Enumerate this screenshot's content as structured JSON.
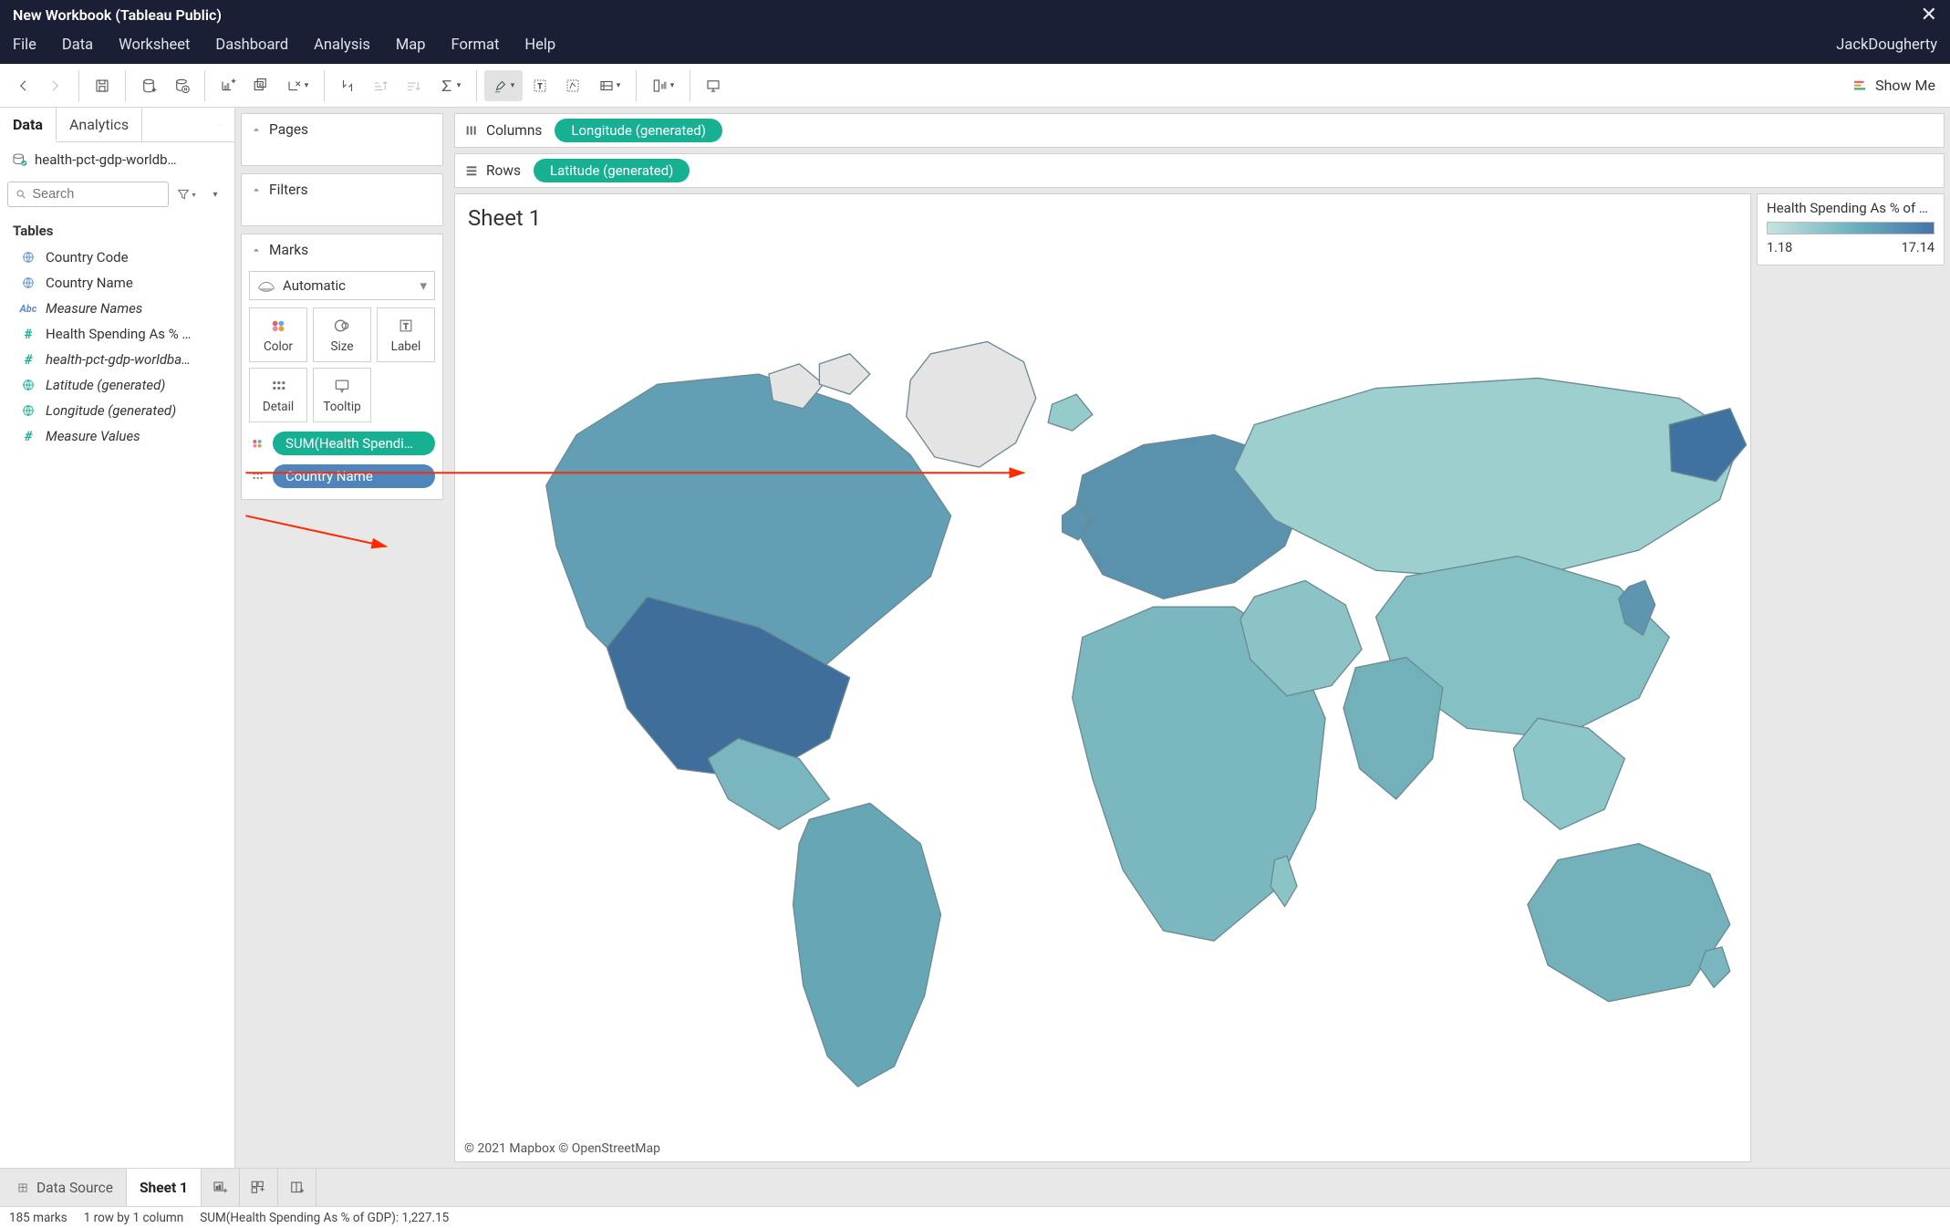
{
  "titlebar": {
    "title": "New Workbook (Tableau Public)"
  },
  "menubar": {
    "items": [
      "File",
      "Data",
      "Worksheet",
      "Dashboard",
      "Analysis",
      "Map",
      "Format",
      "Help"
    ],
    "user": "JackDougherty"
  },
  "showme_label": "Show Me",
  "sidebar": {
    "tabs": {
      "data": "Data",
      "analytics": "Analytics"
    },
    "datasource": "health-pct-gdp-worldb…",
    "search_placeholder": "Search",
    "tables_header": "Tables",
    "fields": [
      {
        "icon": "globe-blue",
        "label": "Country Code",
        "italic": false
      },
      {
        "icon": "globe-blue",
        "label": "Country Name",
        "italic": false
      },
      {
        "icon": "abc",
        "label": "Measure Names",
        "italic": true
      },
      {
        "icon": "hash-green",
        "label": "Health Spending As % …",
        "italic": false
      },
      {
        "icon": "hash-green",
        "label": "health-pct-gdp-worldba…",
        "italic": true
      },
      {
        "icon": "globe-green",
        "label": "Latitude (generated)",
        "italic": true
      },
      {
        "icon": "globe-green",
        "label": "Longitude (generated)",
        "italic": true
      },
      {
        "icon": "hash-green",
        "label": "Measure Values",
        "italic": true
      }
    ]
  },
  "shelves": {
    "pages": "Pages",
    "filters": "Filters",
    "marks": "Marks",
    "marks_type": "Automatic",
    "mark_btns": [
      "Color",
      "Size",
      "Label",
      "Detail",
      "Tooltip"
    ],
    "encodings": [
      {
        "icon": "color",
        "label": "SUM(Health Spendi…",
        "kind": "green"
      },
      {
        "icon": "detail",
        "label": "Country Name",
        "kind": "blue"
      }
    ]
  },
  "viz": {
    "columns_label": "Columns",
    "rows_label": "Rows",
    "columns_pill": "Longitude (generated)",
    "rows_pill": "Latitude (generated)",
    "sheet_title": "Sheet 1",
    "attribution": "© 2021 Mapbox   © OpenStreetMap"
  },
  "legend": {
    "title": "Health Spending As % of …",
    "min": "1.18",
    "max": "17.14"
  },
  "bottom": {
    "data_source": "Data Source",
    "active_sheet": "Sheet 1"
  },
  "status": {
    "marks": "185 marks",
    "rc": "1 row by 1 column",
    "sum": "SUM(Health Spending As % of GDP): 1,227.15"
  }
}
